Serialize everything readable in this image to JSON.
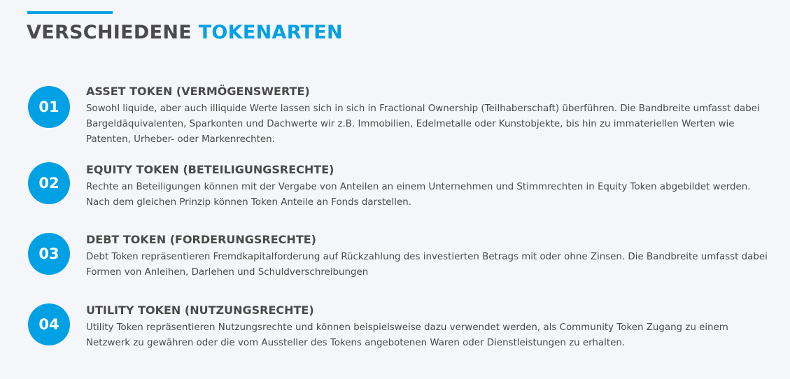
{
  "header": {
    "title_part_1": "VERSCHIEDENE",
    "title_part_2": "TOKENARTEN"
  },
  "tokens": [
    {
      "number": "01",
      "heading": "ASSET TOKEN (VERMÖGENSWERTE)",
      "text": "Sowohl liquide, aber auch illiquide Werte lassen sich in sich in Fractional Ownership (Teilhaberschaft) überführen. Die Bandbreite umfasst dabei Bargeldäquivalenten, Sparkonten und Dachwerte wir z.B. Immobilien, Edelmetalle oder Kunstobjekte, bis hin zu immateriellen Werten wie Patenten, Urheber- oder Markenrechten."
    },
    {
      "number": "02",
      "heading": "EQUITY TOKEN (BETEILIGUNGSRECHTE)",
      "text": "Rechte an Beteiligungen können mit der Vergabe von Anteilen an einem Unternehmen und Stimmrechten in Equity Token abgebildet werden. Nach dem gleichen Prinzip können Token Anteile an Fonds darstellen."
    },
    {
      "number": "03",
      "heading": "DEBT TOKEN (FORDERUNGSRECHTE)",
      "text": "Debt Token repräsentieren Fremdkapitalforderung auf Rückzahlung des investierten Betrags mit oder ohne Zinsen. Die Bandbreite umfasst dabei Formen von Anleihen, Darlehen und Schuldverschreibungen"
    },
    {
      "number": "04",
      "heading": "UTILITY TOKEN (NUTZUNGSRECHTE)",
      "text": "Utility Token repräsentieren Nutzungsrechte und können beispielsweise dazu verwendet werden, als Community Token Zugang zu einem Netzwerk zu gewähren oder die vom Aussteller des Tokens angebotenen Waren oder Dienstleistungen zu erhalten."
    }
  ],
  "colors": {
    "accent": "#00a1e4",
    "text": "#4a4a4a",
    "background": "#f5f6f9"
  }
}
